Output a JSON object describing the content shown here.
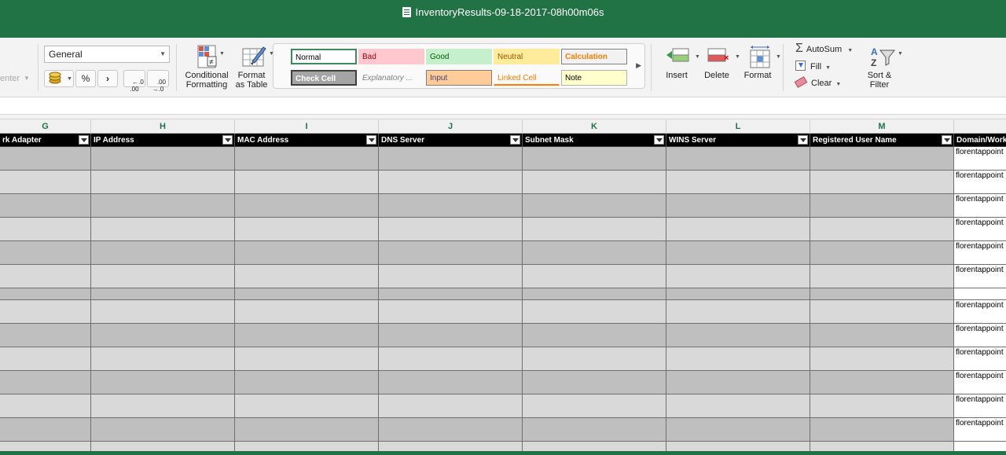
{
  "window": {
    "title": "InventoryResults-09-18-2017-08h00m06s"
  },
  "ribbon": {
    "merge_center_partial": "enter",
    "number_format": "General",
    "percent": "%",
    "comma": "›",
    "inc_decimal": "←.0\n.00",
    "dec_decimal": ".00\n→.0",
    "conditional_formatting": "Conditional\nFormatting",
    "format_as_table": "Format\nas Table",
    "styles": [
      {
        "label": "Normal",
        "bg": "#ffffff",
        "fg": "#000000",
        "border": "#3d8a5f"
      },
      {
        "label": "Bad",
        "bg": "#ffc7ce",
        "fg": "#9c0006",
        "border": "#ffc7ce"
      },
      {
        "label": "Good",
        "bg": "#c6efce",
        "fg": "#006100",
        "border": "#c6efce"
      },
      {
        "label": "Neutral",
        "bg": "#ffeb9c",
        "fg": "#9c5700",
        "border": "#ffeb9c"
      },
      {
        "label": "Calculation",
        "bg": "#f2f2f2",
        "fg": "#fa7d00",
        "border": "#7f7f7f"
      },
      {
        "label": "Check Cell",
        "bg": "#a5a5a5",
        "fg": "#ffffff",
        "border": "#3f3f3f"
      },
      {
        "label": "Explanatory ...",
        "bg": "#fafafa",
        "fg": "#7f7f7f",
        "border": "#fafafa"
      },
      {
        "label": "Input",
        "bg": "#ffcc99",
        "fg": "#3f3f76",
        "border": "#7f7f7f"
      },
      {
        "label": "Linked Cell",
        "bg": "#fafafa",
        "fg": "#fa7d00",
        "border": "#fafafa"
      },
      {
        "label": "Note",
        "bg": "#ffffcc",
        "fg": "#000000",
        "border": "#b2b2b2"
      }
    ],
    "insert": "Insert",
    "delete": "Delete",
    "format": "Format",
    "autosum": "AutoSum",
    "fill": "Fill",
    "clear": "Clear",
    "sort_filter": "Sort &\nFilter"
  },
  "grid": {
    "columns": [
      "G",
      "H",
      "I",
      "J",
      "K",
      "L",
      "M"
    ],
    "headers": [
      "rk Adapter",
      "IP Address",
      "MAC Address",
      "DNS Server",
      "Subnet Mask",
      "WINS Server",
      "Registered User Name",
      "Domain/Work"
    ],
    "rows": [
      {
        "shade": "#bfbfbf",
        "domain": "florentappoint"
      },
      {
        "shade": "#d9d9d9",
        "domain": "florentappoint"
      },
      {
        "shade": "#bfbfbf",
        "domain": "florentappoint"
      },
      {
        "shade": "#d9d9d9",
        "domain": "florentappoint"
      },
      {
        "shade": "#bfbfbf",
        "domain": "florentappoint"
      },
      {
        "shade": "#d9d9d9",
        "domain": "florentappoint"
      },
      {
        "shade": "#bfbfbf",
        "domain": ""
      },
      {
        "shade": "#d9d9d9",
        "domain": "florentappoint"
      },
      {
        "shade": "#bfbfbf",
        "domain": "florentappoint"
      },
      {
        "shade": "#d9d9d9",
        "domain": "florentappoint"
      },
      {
        "shade": "#bfbfbf",
        "domain": "florentappoint"
      },
      {
        "shade": "#d9d9d9",
        "domain": "florentappoint"
      },
      {
        "shade": "#bfbfbf",
        "domain": "florentappoint"
      },
      {
        "shade": "#d9d9d9",
        "domain": ""
      }
    ]
  }
}
